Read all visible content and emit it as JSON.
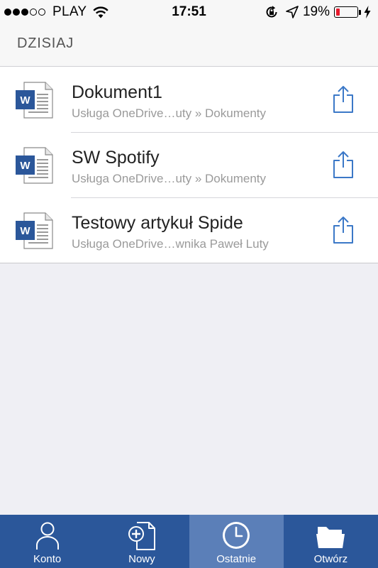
{
  "status_bar": {
    "carrier": "PLAY",
    "time": "17:51",
    "battery_percent": "19%",
    "battery_level": 0.19,
    "signal_bars_filled": 3,
    "signal_bars_total": 5,
    "icons": [
      "wifi-icon",
      "rotation-lock-icon",
      "location-arrow-icon",
      "battery-icon",
      "charging-bolt-icon"
    ]
  },
  "section": {
    "title": "DZISIAJ"
  },
  "documents": [
    {
      "title": "Dokument1",
      "path": "Usługa OneDrive…uty » Dokumenty",
      "icon": "word-document-icon",
      "action_icon": "share-icon"
    },
    {
      "title": "SW Spotify",
      "path": "Usługa OneDrive…uty » Dokumenty",
      "icon": "word-document-icon",
      "action_icon": "share-icon"
    },
    {
      "title": "Testowy artykuł Spide",
      "path": "Usługa OneDrive…wnika Paweł Luty",
      "icon": "word-document-icon",
      "action_icon": "share-icon"
    }
  ],
  "tabs": [
    {
      "label": "Konto",
      "icon": "person-icon",
      "active": false
    },
    {
      "label": "Nowy",
      "icon": "new-document-icon",
      "active": false
    },
    {
      "label": "Ostatnie",
      "icon": "clock-icon",
      "active": true
    },
    {
      "label": "Otwórz",
      "icon": "folder-icon",
      "active": false
    }
  ],
  "colors": {
    "tab_bar": "#2b579a",
    "tab_active": "#5b7fb8",
    "word_blue": "#2b579a",
    "share_blue": "#3b78c7",
    "battery_low": "#e8192c"
  }
}
